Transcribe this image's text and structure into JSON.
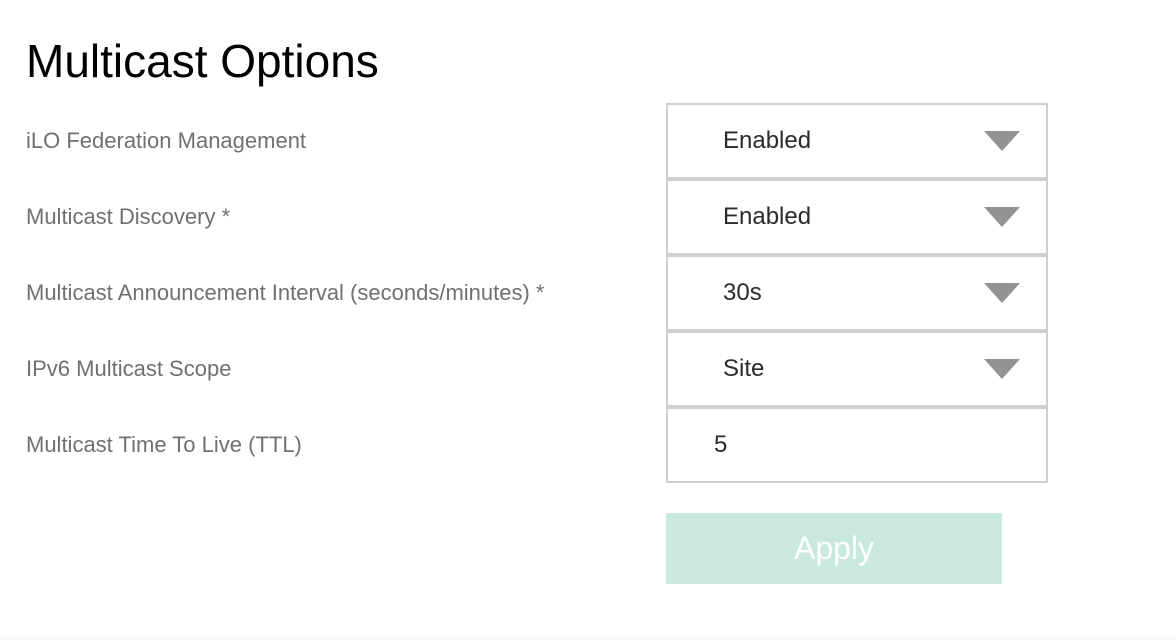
{
  "page": {
    "title": "Multicast Options"
  },
  "fields": [
    {
      "label": "iLO Federation Management",
      "value": "Enabled",
      "control": "select"
    },
    {
      "label": "Multicast Discovery *",
      "value": "Enabled",
      "control": "select"
    },
    {
      "label": "Multicast Announcement Interval (seconds/minutes) *",
      "value": "30s",
      "control": "select"
    },
    {
      "label": "IPv6 Multicast Scope",
      "value": "Site",
      "control": "select"
    },
    {
      "label": "Multicast Time To Live (TTL)",
      "value": "5",
      "control": "text"
    }
  ],
  "actions": {
    "apply_label": "Apply",
    "apply_enabled": false
  },
  "colors": {
    "apply_background": "#cae9de",
    "apply_text": "#ffffff",
    "label_text": "#707070",
    "field_border": "#cfcfcf",
    "dropdown_arrow": "#939393"
  },
  "icons": {
    "dropdown": "triangle-down-icon"
  }
}
